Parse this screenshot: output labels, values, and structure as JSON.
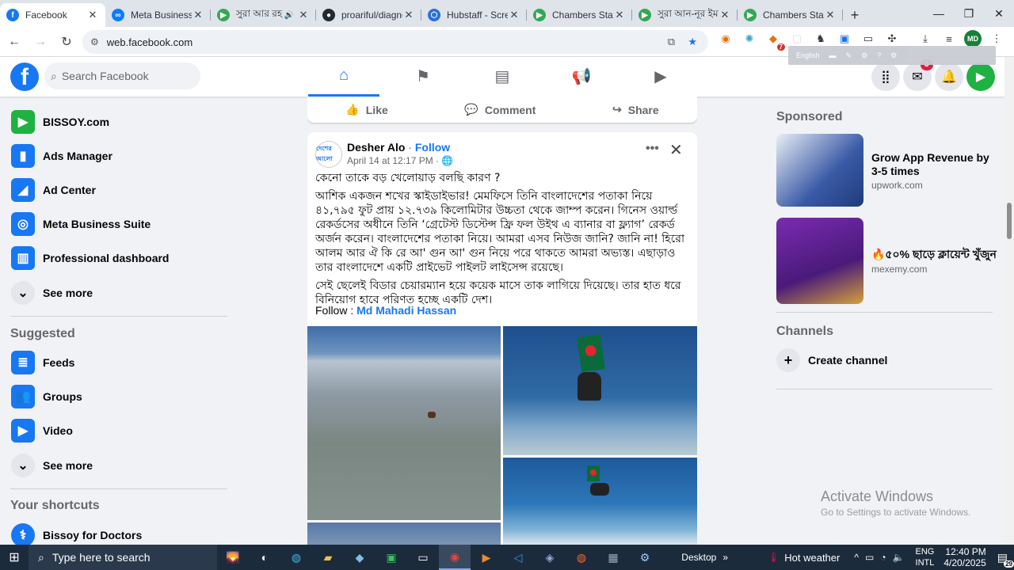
{
  "browser": {
    "tabs": [
      {
        "title": "Facebook",
        "color": "#1877f2",
        "glyph": "f",
        "active": true
      },
      {
        "title": "Meta Business Su",
        "color": "#0a7cff",
        "glyph": "∞"
      },
      {
        "title": "সুরা আর রহ",
        "color": "#34a853",
        "glyph": "▶",
        "extra": "🔊"
      },
      {
        "title": "proariful/diagno",
        "color": "#24292e",
        "glyph": "●"
      },
      {
        "title": "Hubstaff - Scree",
        "color": "#2a6fdb",
        "glyph": "⬡"
      },
      {
        "title": "Chambers State",
        "color": "#34a853",
        "glyph": "▶"
      },
      {
        "title": "সুরা আন-নূর ইমরান",
        "color": "#34a853",
        "glyph": "▶"
      },
      {
        "title": "Chambers State",
        "color": "#34a853",
        "glyph": "▶"
      }
    ],
    "new_tab": "+",
    "url": "web.facebook.com",
    "profile_initials": "MD",
    "ext_badge": "7",
    "translate_lang": "English"
  },
  "fb": {
    "search_placeholder": "Search Facebook",
    "notif_count": "3"
  },
  "leftnav": {
    "items_top": [
      {
        "label": "BISSOY.com",
        "icon": "bissoy-icon",
        "color": "#1fb141"
      },
      {
        "label": "Ads Manager",
        "icon": "ads-manager-icon",
        "color": "#1877f2"
      },
      {
        "label": "Ad Center",
        "icon": "ad-center-icon",
        "color": "#1877f2"
      },
      {
        "label": "Meta Business Suite",
        "icon": "meta-business-icon",
        "color": "#1877f2"
      },
      {
        "label": "Professional dashboard",
        "icon": "dashboard-icon",
        "color": "#1877f2"
      },
      {
        "label": "See more",
        "icon": "chevron-down-icon",
        "color": "#e4e6eb"
      }
    ],
    "suggested_header": "Suggested",
    "items_suggested": [
      {
        "label": "Feeds",
        "icon": "feeds-icon",
        "color": "#1877f2"
      },
      {
        "label": "Groups",
        "icon": "groups-icon",
        "color": "#1877f2"
      },
      {
        "label": "Video",
        "icon": "video-icon",
        "color": "#1877f2"
      },
      {
        "label": "See more",
        "icon": "chevron-down-icon",
        "color": "#e4e6eb"
      }
    ],
    "shortcuts_header": "Your shortcuts",
    "shortcut": "Bissoy for Doctors"
  },
  "feed": {
    "actions": [
      "Like",
      "Comment",
      "Share"
    ],
    "post": {
      "author": "Desher Alo",
      "dot": " · ",
      "follow": "Follow",
      "date": "April 14 at 12:17 PM · ",
      "avatar_text": "দেশের আলো",
      "paragraphs": [
        "কেনো তাকে বড় খেলোয়াড় বলছি কারণ ?",
        "আশিক একজন শখের স্কাইডাইভার! মেমফিসে তিনি বাংলাদেশের পতাকা নিয়ে ৪১,৭৯৫ ফুট প্রায় ১২.৭৩৯ কিলোমিটার উচ্চতা থেকে জাম্প করেন। গিনেস ওয়ার্ল্ড রেকর্ডসের অধীনে তিনি ‘গ্রেটেস্ট ডিস্টেন্স ফ্রি ফল উইথ এ ব্যানার বা ফ্ল্যাগ’ রেকর্ড অর্জন করেন। বাংলাদেশের পতাকা নিয়ে। আমরা এসব নিউজ জানি? জানি না! হিরো আলম আর ঐ কি রে আ' গুন আ' গুন নিয়ে পরে থাকতে আমরা অভ্যস্ত। এছাড়াও তার বাংলাদেশে একটি প্রাইভেট পাইলট লাইসেন্স রয়েছে।",
        "সেই ছেলেই বিডার চেয়ারম্যান হয়ে কয়েক মাসে তাক লাগিয়ে দিয়েছে। তার হাত ধরে বিনিয়োগ হাবে পরিণত হচ্ছে একটি দেশ।"
      ],
      "follow_prefix": "Follow : ",
      "follow_name": "Md Mahadi Hassan"
    }
  },
  "right": {
    "sponsored": "Sponsored",
    "ads": [
      {
        "title": "Grow App Revenue by 3-5 times",
        "domain": "upwork.com",
        "color": "#2b4fa0"
      },
      {
        "title": "🔥৫০% ছাড়ে ক্লায়েন্ট খুঁজুন",
        "domain": "mexemy.com",
        "color": "#6b2a8c"
      }
    ],
    "channels": "Channels",
    "create_channel": "Create channel"
  },
  "watermark": {
    "line1": "Activate Windows",
    "line2": "Go to Settings to activate Windows."
  },
  "taskbar": {
    "search": "Type here to search",
    "desktop": "Desktop",
    "weather": "Hot weather",
    "lang1": "ENG",
    "lang2": "INTL",
    "time": "12:40 PM",
    "date": "4/20/2025",
    "notif": "29"
  }
}
